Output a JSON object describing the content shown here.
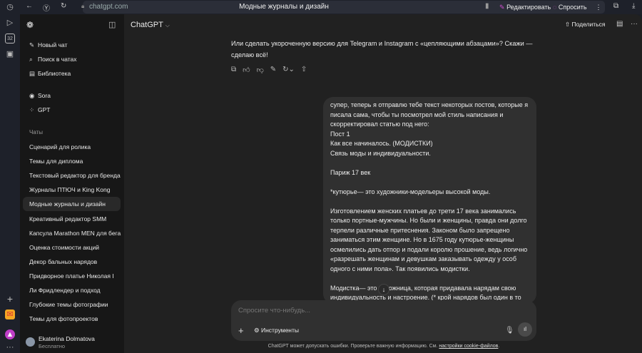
{
  "browser": {
    "url": "chatgpt.com",
    "title": "Модные журналы и дизайн",
    "edit_label": "Редактировать",
    "ask_label": "Спросить",
    "rail_badge": "32"
  },
  "sidebar": {
    "new_chat": "Новый чат",
    "search": "Поиск в чатах",
    "library": "Библиотека",
    "sora": "Sora",
    "gpt": "GPT",
    "chats_header": "Чаты",
    "chats": [
      "Сценарий для ролика",
      "Темы для диплома",
      "Текстовый редактор для бренда",
      "Журналы ПТЮЧ и King Kong",
      "Модные журналы и дизайн",
      "Креативный редактор SMM",
      "Капсула Marathon MEN для бега",
      "Оценка стоимости акций",
      "Декор бальных нарядов",
      "Придворное платье Николая I",
      "Ли Фридлендер и подход",
      "Глубокие темы фотографии",
      "Темы для фотопроектов"
    ],
    "user_name": "Ekaterina Dolmatova",
    "user_plan": "Бесплатно"
  },
  "header": {
    "model": "ChatGPT",
    "share": "Поделиться"
  },
  "assistant_message": "Или сделать укороченную версию для Telegram и Instagram с «цепляющими абзацами»? Скажи — сделаю всё!",
  "user_message": [
    "супер, теперь я отправлю тебе текст некоторых постов, которые я писала сама, чтобы ты посмотрел мой стиль написания и скорректировал статью под него:",
    "Пост 1",
    "Как все начиналось. (МОДИСТКИ)",
    "Связь моды и индивидуальности.",
    "",
    "Париж 17 век",
    "",
    "*кутюрье— это художники-модельеры высокой моды.",
    "",
    "Изготовлением женских платьев до трети 17 века занимались только портные-мужчины. Но были и женщины, правда они долго терпели различные притеснения. Законом было запрещено заниматься этим женщине. Но в 1675 году кутюрье-женщины осмелились дать отпор и подали королю прошение, ведь логично «разрешать женщинам и девушкам заказывать одежду у особ одного с ними пола». Так появились модистки.",
    "",
    "Модистка— это художница, которая придавала нарядам свою индивидуальность и настроение. (* крой нарядов был один в то"
  ],
  "composer": {
    "placeholder": "Спросите что-нибудь...",
    "tools": "Инструменты"
  },
  "footer": {
    "text": "ChatGPT может допускать ошибки. Проверьте важную информацию. См. ",
    "link": "настройки cookie-файлов",
    "end": "."
  }
}
